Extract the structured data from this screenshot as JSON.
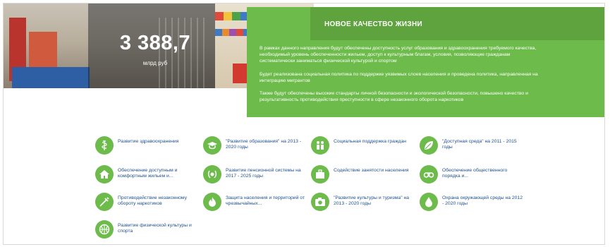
{
  "hero": {
    "value": "3 388,7",
    "unit": "млрд руб",
    "chevron": "⌄"
  },
  "panel": {
    "title": "НОВОЕ КАЧЕСТВО ЖИЗНИ",
    "paragraphs": [
      "В рамках данного направления будут обеспечены доступность услуг образования и здравоохранения требуемого качества, необходимый уровень обеспеченности жильем, доступ к культурным благам, условия, позволяющие гражданам систематически заниматься физической культурой и спортом",
      "Будет реализована социальная политика по поддержке уязвимых слоев населения и проведена политика, направленная на интеграцию мигрантов",
      "Также будут обеспечены высокие стандарты личной безопасности и экологической безопасности, повышено качество и результативность противодействия преступности в сфере незаконного оборота наркотиков"
    ]
  },
  "side_nav": {
    "up": "˄",
    "dots": 5,
    "active": 0
  },
  "programs": [
    {
      "label": "Развитие здравоохранения",
      "icon": "medical-caduceus-icon"
    },
    {
      "label": "\"Развитие образования\" на 2013 - 2020 годы",
      "icon": "graduation-cap-icon"
    },
    {
      "label": "Социальная поддержка граждан",
      "icon": "people-icon"
    },
    {
      "label": "\"Доступная среда\" на 2011 - 2015 годы",
      "icon": "leaf-icon"
    },
    {
      "label": "Обеспечение доступным и комфортным жильем и...",
      "icon": "house-icon"
    },
    {
      "label": "Развитие пенсионной системы на 2017 - 2025 годы",
      "icon": "pension-laurel-icon"
    },
    {
      "label": "Содействие занятости населения",
      "icon": "briefcase-icon"
    },
    {
      "label": "Обеспечение общественного порядка и...",
      "icon": "handcuffs-icon"
    },
    {
      "label": "Противодействие незаконному обороту наркотиков",
      "icon": "syringe-icon"
    },
    {
      "label": "Защита населения и территорий от чрезвычайных...",
      "icon": "fire-icon"
    },
    {
      "label": "\"Развитие культуры и туризма\" на 2013 - 2020 годы",
      "icon": "camera-icon"
    },
    {
      "label": "Охрана окружающей среды на 2012 - 2020 годы",
      "icon": "water-drop-icon"
    },
    {
      "label": "Развитие физической культуры и спорта",
      "icon": "ball-icon"
    }
  ]
}
